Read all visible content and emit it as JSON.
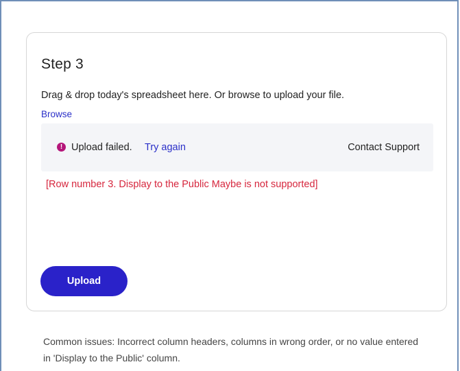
{
  "step": {
    "title": "Step 3",
    "instructions": "Drag & drop today's spreadsheet here. Or browse to upload your file.",
    "browse_label": "Browse"
  },
  "upload_status": {
    "icon": "exclamation-circle-icon",
    "icon_glyph": "!",
    "icon_color": "#b5167a",
    "message": "Upload failed.",
    "retry_label": "Try again",
    "support_label": "Contact Support"
  },
  "error": {
    "message": "[Row number 3. Display to the Public Maybe is not supported]",
    "color": "#d6263d"
  },
  "actions": {
    "upload_label": "Upload",
    "upload_color": "#2a22c9"
  },
  "help": {
    "text": "Common issues: Incorrect column headers, columns in wrong order, or no value entered in 'Display to the Public' column."
  },
  "colors": {
    "link": "#2a2fc8",
    "status_background": "#f4f5f8"
  }
}
